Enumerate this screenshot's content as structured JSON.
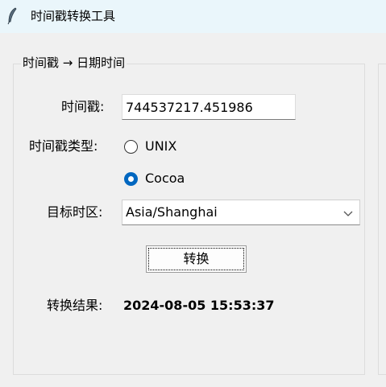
{
  "window": {
    "title": "时间戳转换工具",
    "icon": "feather-icon"
  },
  "group": {
    "legend": "时间戳 → 日期时间"
  },
  "timestamp": {
    "label": "时间戳:",
    "value": "744537217.451986"
  },
  "timestamp_type": {
    "label": "时间戳类型:",
    "options": [
      {
        "label": "UNIX",
        "checked": false
      },
      {
        "label": "Cocoa",
        "checked": true
      }
    ]
  },
  "timezone": {
    "label": "目标时区:",
    "value": "Asia/Shanghai",
    "icon": "chevron-down-icon"
  },
  "convert_button": {
    "label": "转换"
  },
  "result": {
    "label": "转换结果:",
    "value": "2024-08-05 15:53:37"
  },
  "colors": {
    "titlebar": "#eaf6fb",
    "background": "#f0f0f0",
    "accent": "#0067c0"
  }
}
